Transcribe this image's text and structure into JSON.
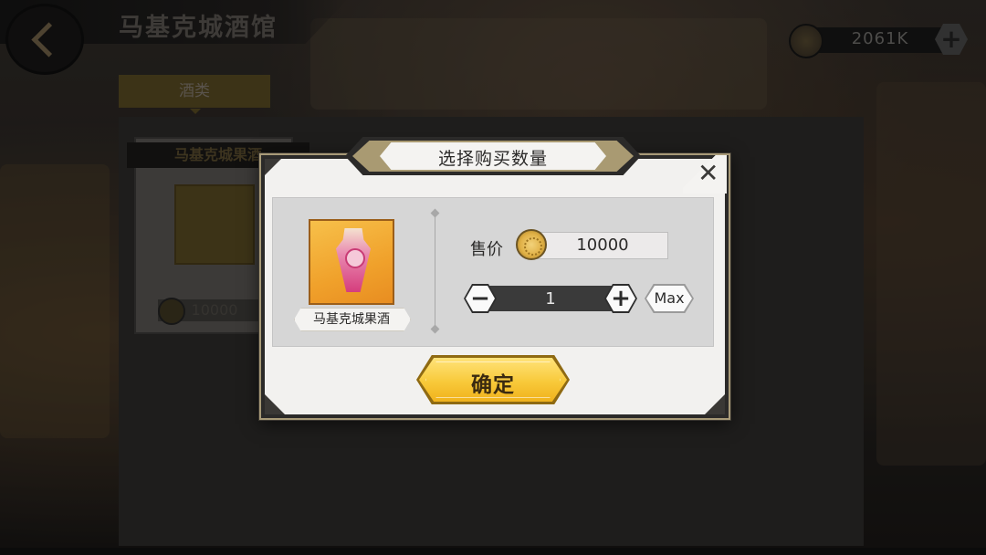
{
  "header": {
    "title": "马基克城酒馆",
    "currency_amount": "2061K",
    "currency_plus": "+"
  },
  "shop": {
    "category_tab": "酒类",
    "card": {
      "title": "马基克城果酒",
      "price": "10000"
    }
  },
  "dialog": {
    "title": "选择购买数量",
    "close_glyph": "✕",
    "item_name": "马基克城果酒",
    "price_label": "售价",
    "price_value": "10000",
    "quantity": "1",
    "minus_glyph": "−",
    "plus_glyph": "+",
    "max_label": "Max",
    "confirm_label": "确定"
  },
  "colors": {
    "accent_gold": "#f8c93a",
    "item_frame": "#f0a12b",
    "potion_pink": "#d53d7d",
    "dialog_bg": "#f2f1ef"
  }
}
